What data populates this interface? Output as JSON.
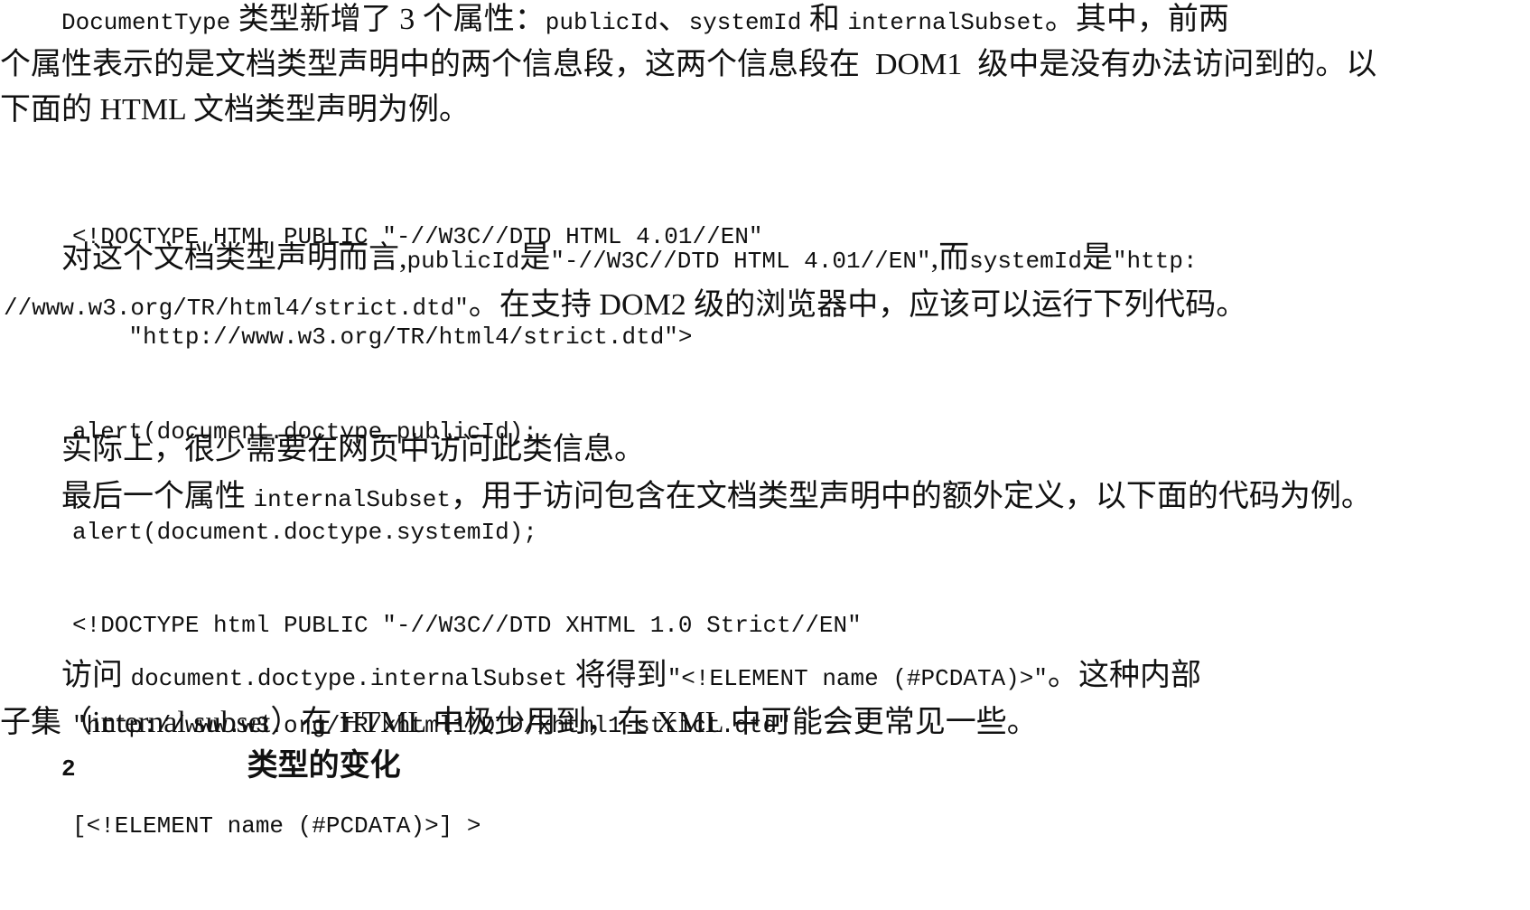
{
  "paragraph_1": {
    "line_1": {
      "code_1": "DocumentType",
      "text_1": " 类型新增了 3 个属性：",
      "code_2": "publicId",
      "text_2": "、",
      "code_3": "systemId",
      "text_3": " 和 ",
      "code_4": "internalSubset",
      "text_4": "。其中，前两"
    },
    "line_2": "个属性表示的是文档类型声明中的两个信息段，这两个信息段在  DOM1  级中是没有办法访问到的。以",
    "line_3": "下面的 HTML 文档类型声明为例。"
  },
  "code_block_1": {
    "lines": [
      "<!DOCTYPE HTML PUBLIC \"-//W3C//DTD HTML 4.01//EN\"",
      "    \"http://www.w3.org/TR/html4/strict.dtd\">"
    ]
  },
  "paragraph_2": {
    "line_1": {
      "text_1": "对这个文档类型声明而言,",
      "code_1": "publicId",
      "text_2": "是",
      "code_2": "\"-//W3C//DTD HTML 4.01//EN\"",
      "text_3": ",而",
      "code_3": "systemId",
      "text_4": "是",
      "code_4": "\"http:"
    },
    "line_2": {
      "code_1": "//www.w3.org/TR/html4/strict.dtd\"",
      "text_1": "。在支持 DOM2 级的浏览器中，应该可以运行下列代码。"
    }
  },
  "code_block_2": {
    "lines": [
      "alert(document.doctype.publicId);",
      "alert(document.doctype.systemId);"
    ]
  },
  "paragraph_3": {
    "line_1": "实际上，很少需要在网页中访问此类信息。"
  },
  "paragraph_4": {
    "line_1": {
      "text_1": "最后一个属性 ",
      "code_1": "internalSubset",
      "text_2": "，用于访问包含在文档类型声明中的额外定义，以下面的代码为例。"
    }
  },
  "code_block_3": {
    "lines": [
      "<!DOCTYPE html PUBLIC \"-//W3C//DTD XHTML 1.0 Strict//EN\"",
      "\"http://www.w3.org/TR/xhtml1/DTD/xhtml1-strict.dtd\"",
      "[<!ELEMENT name (#PCDATA)>] >"
    ]
  },
  "paragraph_5": {
    "line_1": {
      "text_1": "访问 ",
      "code_1": "document.doctype.internalSubset",
      "text_2": " 将得到",
      "code_2": "\"<!ELEMENT name (#PCDATA)>\"",
      "text_3": "。这种内部"
    },
    "line_2": "子集（internal subset）在 HTML 中极少用到，在 XML 中可能会更常见一些。"
  },
  "partial_heading": {
    "code_1": "2",
    "text_1": "类型的变化"
  }
}
